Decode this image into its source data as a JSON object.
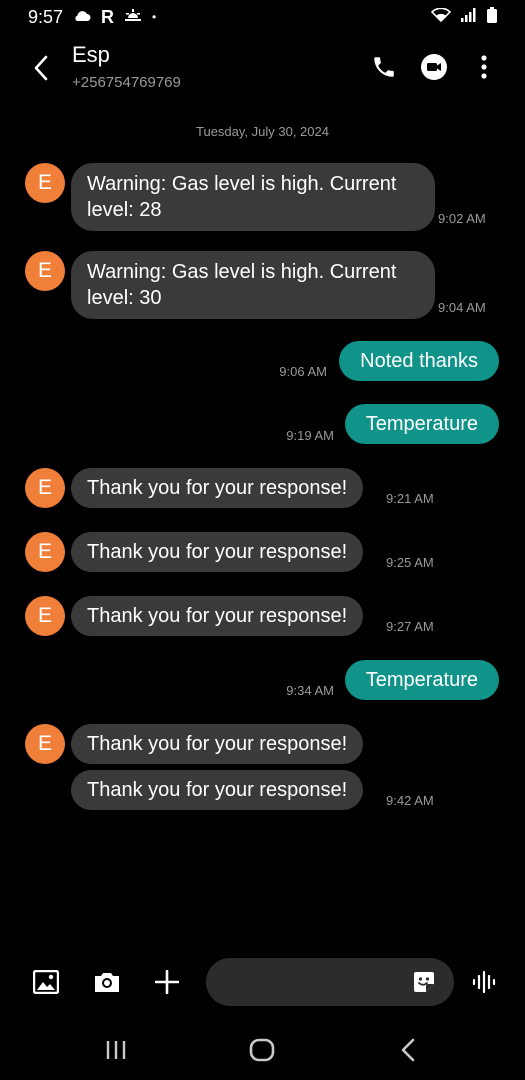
{
  "status_bar": {
    "time": "9:57",
    "left_icons": [
      "cloud-icon",
      "r-app-icon",
      "sunrise-icon"
    ],
    "dot": "•",
    "right_icons": [
      "wifi-icon",
      "signal-icon",
      "battery-icon"
    ]
  },
  "header": {
    "contact_name": "Esp",
    "contact_number": "+256754769769",
    "actions": [
      "call-icon",
      "video-call-icon",
      "more-options-icon"
    ]
  },
  "conversation": {
    "date": "Tuesday, July 30, 2024",
    "avatar_initial": "E",
    "messages": [
      {
        "direction": "incoming",
        "text": "Warning: Gas level is high. Current level: 28",
        "time": "9:02 AM"
      },
      {
        "direction": "incoming",
        "text": "Warning: Gas level is high. Current level: 30",
        "time": "9:04 AM"
      },
      {
        "direction": "outgoing",
        "text": "Noted thanks",
        "time": "9:06 AM"
      },
      {
        "direction": "outgoing",
        "text": "Temperature",
        "time": "9:19 AM"
      },
      {
        "direction": "incoming",
        "text": "Thank you for your response!",
        "time": "9:21 AM"
      },
      {
        "direction": "incoming",
        "text": "Thank you for your response!",
        "time": "9:25 AM"
      },
      {
        "direction": "incoming",
        "text": "Thank you for your response!",
        "time": "9:27 AM"
      },
      {
        "direction": "outgoing",
        "text": "Temperature",
        "time": "9:34 AM"
      },
      {
        "direction": "incoming",
        "text": "Thank you for your response!",
        "time": ""
      },
      {
        "direction": "incoming",
        "text": "Thank you for your response!",
        "time": "9:42 AM"
      }
    ]
  },
  "composer": {
    "input_value": "",
    "input_placeholder": "",
    "buttons": [
      "gallery-icon",
      "camera-icon",
      "add-icon",
      "sticker-icon",
      "voice-recorder-icon"
    ]
  },
  "nav_bar": {
    "buttons": [
      "recent-apps-icon",
      "home-icon",
      "back-nav-icon"
    ]
  },
  "colors": {
    "background": "#000000",
    "incoming_bubble": "#3a3a3a",
    "outgoing_bubble": "#10948a",
    "avatar": "#f07f3a",
    "secondary_text": "#9a9a9a"
  }
}
